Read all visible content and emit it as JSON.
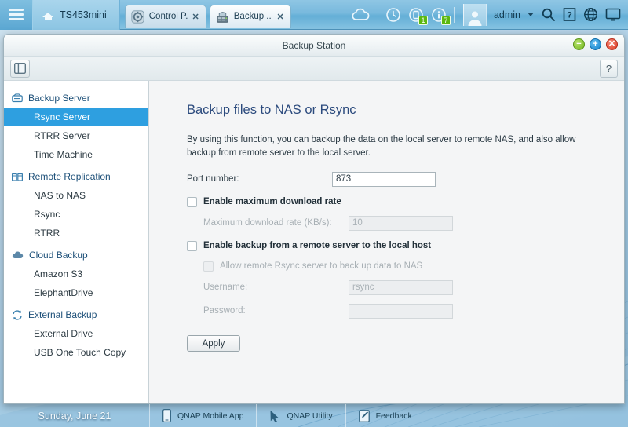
{
  "topbar": {
    "menu_icon": "hamburger-menu-icon",
    "home_icon": "home-icon",
    "hostname": "TS453mini",
    "tabs": [
      {
        "label": "Control P...",
        "icon": "gear-icon",
        "close": "✕",
        "active": false
      },
      {
        "label": "Backup ...",
        "icon": "nas-server-icon",
        "close": "✕",
        "active": true
      }
    ],
    "tray": [
      {
        "name": "cloud-icon"
      },
      {
        "name": "clock-icon"
      },
      {
        "name": "backup-sync-icon",
        "badge": "1"
      },
      {
        "name": "info-icon",
        "badge": "7"
      }
    ],
    "user": {
      "avatar": "user-avatar-icon",
      "name": "admin",
      "caret": "chevron-down-icon"
    },
    "right_icons": [
      {
        "name": "search-icon"
      },
      {
        "name": "help-icon",
        "glyph": "?"
      },
      {
        "name": "globe-icon"
      },
      {
        "name": "monitor-icon"
      }
    ]
  },
  "window": {
    "title": "Backup Station",
    "controls": {
      "minimize": "−",
      "maximize": "+",
      "close": "✕"
    },
    "toolbar": {
      "panel_toggle": "panel-toggle-icon",
      "help": "?"
    }
  },
  "sidebar": {
    "groups": [
      {
        "label": "Backup Server",
        "icon": "backup-server-icon",
        "items": [
          {
            "label": "Rsync Server",
            "active": true
          },
          {
            "label": "RTRR Server",
            "active": false
          },
          {
            "label": "Time Machine",
            "active": false
          }
        ]
      },
      {
        "label": "Remote Replication",
        "icon": "remote-replication-icon",
        "items": [
          {
            "label": "NAS to NAS",
            "active": false
          },
          {
            "label": "Rsync",
            "active": false
          },
          {
            "label": "RTRR",
            "active": false
          }
        ]
      },
      {
        "label": "Cloud Backup",
        "icon": "cloud-backup-icon",
        "items": [
          {
            "label": "Amazon S3",
            "active": false
          },
          {
            "label": "ElephantDrive",
            "active": false
          }
        ]
      },
      {
        "label": "External Backup",
        "icon": "external-backup-icon",
        "items": [
          {
            "label": "External Drive",
            "active": false
          },
          {
            "label": "USB One Touch Copy",
            "active": false
          }
        ]
      }
    ]
  },
  "main": {
    "title": "Backup files to NAS or Rsync",
    "description": "By using this function, you can backup the data on the local server to remote NAS, and also allow backup from remote server to the local server.",
    "port_label": "Port number:",
    "port_value": "873",
    "enable_max_rate_label": "Enable maximum download rate",
    "enable_max_rate_checked": false,
    "max_rate_label": "Maximum download rate (KB/s):",
    "max_rate_value": "10",
    "max_rate_enabled": false,
    "enable_remote_backup_label": "Enable backup from a remote server to the local host",
    "enable_remote_backup_checked": false,
    "allow_remote_rsync_label": "Allow remote Rsync server to back up data to NAS",
    "allow_remote_rsync_checked": false,
    "username_label": "Username:",
    "username_value": "rsync",
    "password_label": "Password:",
    "password_value": "",
    "apply_label": "Apply"
  },
  "bottombar": {
    "date": "Sunday, June 21",
    "items": [
      {
        "label": "QNAP Mobile App",
        "icon": "mobile-phone-icon"
      },
      {
        "label": "QNAP Utility",
        "icon": "cursor-arrow-icon"
      },
      {
        "label": "Feedback",
        "icon": "pencil-edit-icon"
      }
    ]
  },
  "colors": {
    "accent_blue": "#2e9fe0",
    "topbar_blue": "#78b9dd",
    "title_text": "#2b4a7d",
    "badge_green": "#5cb811"
  }
}
